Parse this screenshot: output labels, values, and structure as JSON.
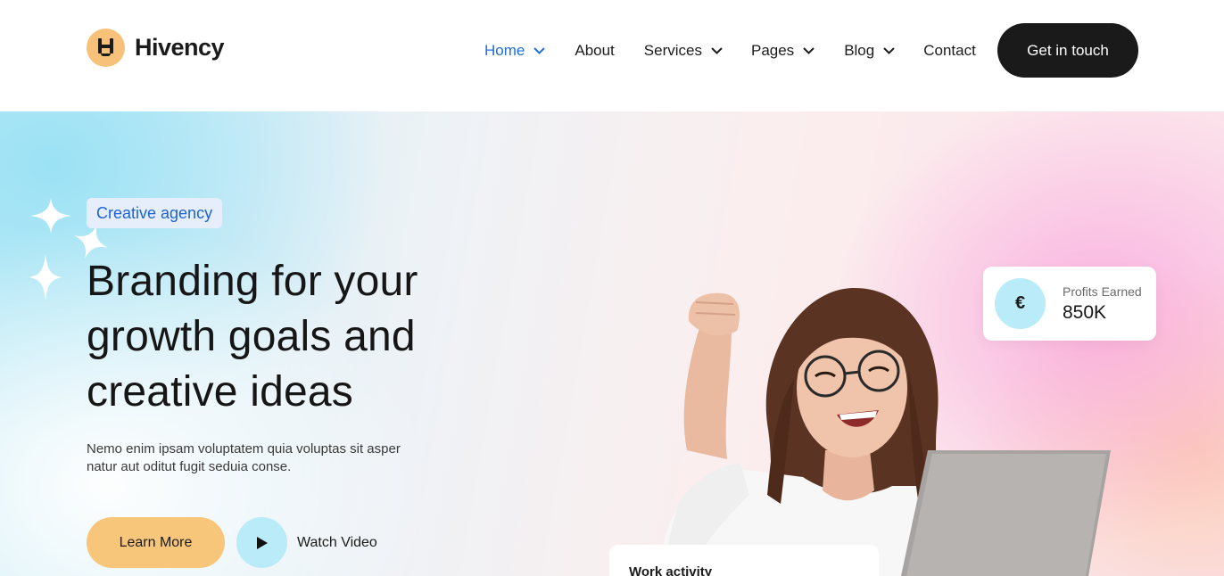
{
  "brand": {
    "name": "Hivency",
    "logo_icon": "hive-logo-icon"
  },
  "nav": {
    "items": [
      {
        "label": "Home",
        "active": true,
        "has_dropdown": true
      },
      {
        "label": "About",
        "active": false,
        "has_dropdown": false
      },
      {
        "label": "Services",
        "active": false,
        "has_dropdown": true
      },
      {
        "label": "Pages",
        "active": false,
        "has_dropdown": true
      },
      {
        "label": "Blog",
        "active": false,
        "has_dropdown": true
      },
      {
        "label": "Contact",
        "active": false,
        "has_dropdown": false
      }
    ],
    "cta_label": "Get in touch"
  },
  "hero": {
    "badge": "Creative agency",
    "title_line1": "Branding for your",
    "title_line2": "growth goals and",
    "title_line3": "creative ideas",
    "description_line1": "Nemo enim ipsam voluptatem quia voluptas sit asper",
    "description_line2": "natur aut oditut fugit seduia conse.",
    "learn_more_label": "Learn More",
    "watch_video_label": "Watch Video"
  },
  "profit_card": {
    "icon": "€",
    "label": "Profits Earned",
    "value": "850K"
  },
  "work_card": {
    "title": "Work activity"
  },
  "colors": {
    "accent_blue": "#1e6fd9",
    "cta_dark": "#1a1a1a",
    "learn_more_bg": "#f7c67b",
    "play_bg": "#b9ebf8",
    "logo_bg": "#f7c17a"
  }
}
